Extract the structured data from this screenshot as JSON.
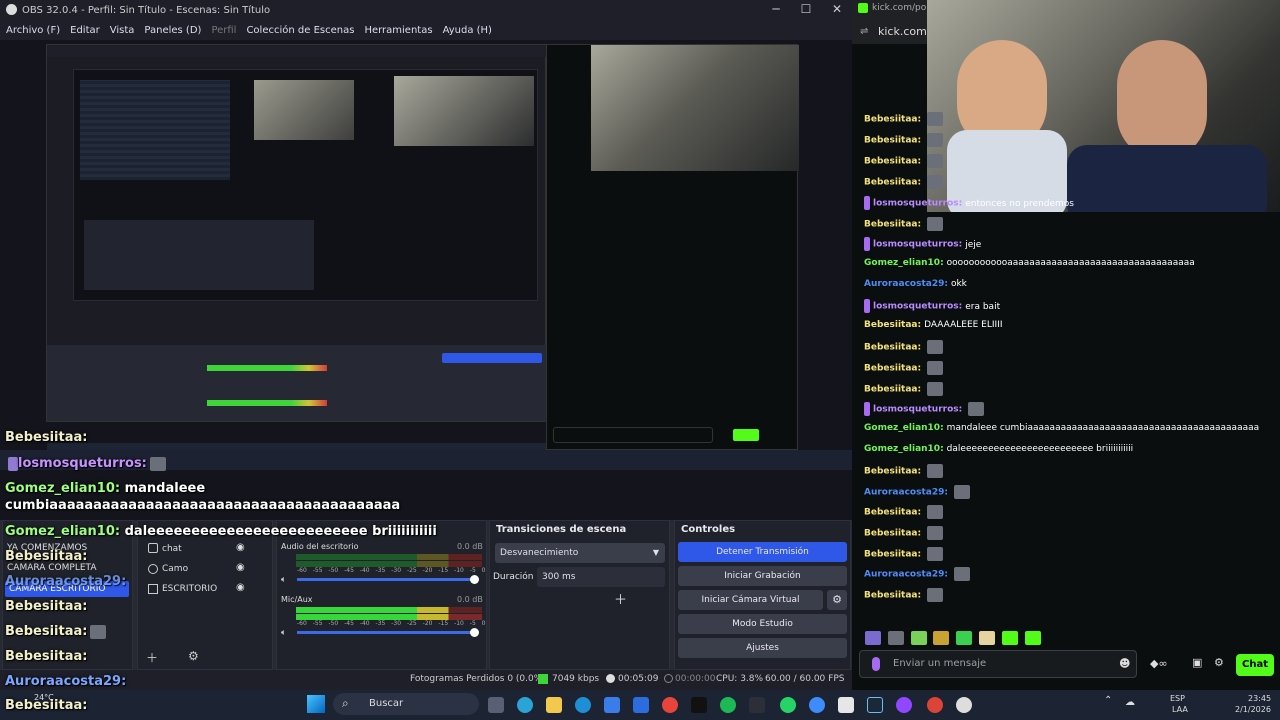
{
  "obs": {
    "title": "OBS 32.0.4 - Perfil: Sin Título - Escenas: Sin Título",
    "menu": [
      "Archivo (F)",
      "Editar",
      "Vista",
      "Paneles (D)",
      "Perfil",
      "Colección de Escenas",
      "Herramientas",
      "Ayuda (H)"
    ],
    "scenes": [
      "YA COMENZAMOS",
      "CAMARA COMPLETA",
      "CAMARA ESCRITORIO"
    ],
    "sources": [
      "chat",
      "Camo",
      "ESCRITORIO"
    ],
    "mixer": {
      "desktop_label": "Audio del escritorio",
      "desktop_db": "0.0 dB",
      "mic_label": "Mic/Aux",
      "mic_db": "0.0 dB",
      "ticks": [
        "-60",
        "-55",
        "-50",
        "-45",
        "-40",
        "-35",
        "-30",
        "-25",
        "-20",
        "-15",
        "-10",
        "-5",
        "0"
      ]
    },
    "transitions": {
      "header": "Transiciones de escena",
      "type": "Desvanecimiento",
      "duration_label": "Duración",
      "duration_value": "300 ms"
    },
    "controls": {
      "header": "Controles",
      "stop_stream": "Detener Transmisión",
      "start_rec": "Iniciar Grabación",
      "virtual_cam": "Iniciar Cámara Virtual",
      "studio": "Modo Estudio",
      "settings": "Ajustes"
    },
    "status": {
      "dropped": "Fotogramas Perdidos 0 (0.0%)",
      "kbps": "7049 kbps",
      "stream_time": "00:05:09",
      "rec_time": "00:00:00",
      "cpu": "CPU: 3.8%",
      "fps": "60.00 / 60.00 FPS"
    },
    "overlay_chat": [
      {
        "user": "Bebesiitaa:",
        "color": "#f1f0c8",
        "msg": ""
      },
      {
        "user": "losmosqueturros:",
        "color": "#c792ff",
        "msg": ""
      },
      {
        "user": "Gomez_elian10:",
        "color": "#9dff7e",
        "msg": "mandaleee"
      },
      {
        "user": "",
        "color": "#ffffff",
        "msg": "cumbiaaaaaaaaaaaaaaaaaaaaaaaaaaaaaaaaaaaaaaaa"
      },
      {
        "user": "Gomez_elian10:",
        "color": "#9dff7e",
        "msg": "daleeeeeeeeeeeeeeeeeeeeeeeee briiiiiiiiiii"
      },
      {
        "user": "Bebesiitaa:",
        "color": "#f1f0c8",
        "msg": ""
      },
      {
        "user": "Auroraacosta29:",
        "color": "#7aa7ff",
        "msg": ""
      },
      {
        "user": "Bebesiitaa:",
        "color": "#f1f0c8",
        "msg": ""
      },
      {
        "user": "Bebesiitaa:",
        "color": "#f1f0c8",
        "msg": ""
      },
      {
        "user": "Bebesiitaa:",
        "color": "#f1f0c8",
        "msg": ""
      },
      {
        "user": "Auroraacosta29:",
        "color": "#7aa7ff",
        "msg": ""
      },
      {
        "user": "Bebesiitaa:",
        "color": "#f1f0c8",
        "msg": ""
      }
    ]
  },
  "browser": {
    "tab_text": "kick.com/popo",
    "url": "kick.com/po",
    "chat": [
      {
        "user": "Bebesiitaa:",
        "color": "#f6e37a",
        "msg": ""
      },
      {
        "user": "Bebesiitaa:",
        "color": "#f6e37a",
        "msg": ""
      },
      {
        "user": "Bebesiitaa:",
        "color": "#f6e37a",
        "msg": ""
      },
      {
        "user": "Bebesiitaa:",
        "color": "#f6e37a",
        "msg": ""
      },
      {
        "user": "losmosqueturros:",
        "color": "#b98bff",
        "msg": "entonces no prendemos"
      },
      {
        "user": "Bebesiitaa:",
        "color": "#f6e37a",
        "msg": ""
      },
      {
        "user": "losmosqueturros:",
        "color": "#b98bff",
        "msg": "jeje"
      },
      {
        "user": "Gomez_elian10:",
        "color": "#72f257",
        "msg": "oooooooooooaaaaaaaaaaaaaaaaaaaaaaaaaaaaaaaaaa"
      },
      {
        "user": "Auroraacosta29:",
        "color": "#4f8cf6",
        "msg": "okk"
      },
      {
        "user": "losmosqueturros:",
        "color": "#b98bff",
        "msg": "era bait"
      },
      {
        "user": "Bebesiitaa:",
        "color": "#f6e37a",
        "msg": "DAAAALEEE ELIIII"
      },
      {
        "user": "Bebesiitaa:",
        "color": "#f6e37a",
        "msg": ""
      },
      {
        "user": "Bebesiitaa:",
        "color": "#f6e37a",
        "msg": ""
      },
      {
        "user": "Bebesiitaa:",
        "color": "#f6e37a",
        "msg": ""
      },
      {
        "user": "losmosqueturros:",
        "color": "#b98bff",
        "msg": ""
      },
      {
        "user": "Gomez_elian10:",
        "color": "#72f257",
        "msg": "mandaleee cumbiaaaaaaaaaaaaaaaaaaaaaaaaaaaaaaaaaaaaaaaaaa"
      },
      {
        "user": "Gomez_elian10:",
        "color": "#72f257",
        "msg": "daleeeeeeeeeeeeeeeeeeeeeeee briiiiiiiiiii"
      },
      {
        "user": "Bebesiitaa:",
        "color": "#f6e37a",
        "msg": ""
      },
      {
        "user": "Auroraacosta29:",
        "color": "#4f8cf6",
        "msg": ""
      },
      {
        "user": "Bebesiitaa:",
        "color": "#f6e37a",
        "msg": ""
      },
      {
        "user": "Bebesiitaa:",
        "color": "#f6e37a",
        "msg": ""
      },
      {
        "user": "Bebesiitaa:",
        "color": "#f6e37a",
        "msg": ""
      },
      {
        "user": "Auroraacosta29:",
        "color": "#4f8cf6",
        "msg": ""
      },
      {
        "user": "Bebesiitaa:",
        "color": "#f6e37a",
        "msg": ""
      }
    ],
    "input_placeholder": "Enviar un mensaje",
    "chat_button": "Chat",
    "accent": "#53fc18"
  },
  "taskbar": {
    "weather": "24°C",
    "search": "Buscar",
    "lang": "ESP",
    "region": "LAA",
    "time": "23:45",
    "date": "2/1/2026"
  }
}
